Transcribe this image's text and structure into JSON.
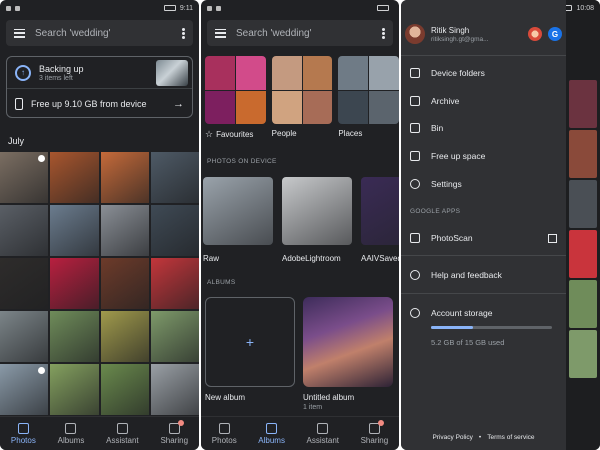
{
  "status": {
    "p1_time": "9:11",
    "p2_time": "",
    "p3_time": "10:08",
    "battery": "75"
  },
  "search": {
    "placeholder": "Search 'wedding'"
  },
  "photos_panel": {
    "backup_title": "Backing up",
    "backup_sub": "3 items left",
    "free_up": "Free up 9.10 GB from device",
    "month": "July",
    "thumb_colors": [
      "#7b6e62",
      "#a8562e",
      "#c46a3a",
      "#4e5a66",
      "#5a5f66",
      "#6b7c8e",
      "#8a8f96",
      "#3f4a55",
      "#2e2c2b",
      "#b81f3f",
      "#6d3b2a",
      "#c3363b",
      "#7c8589",
      "#6f8c5a",
      "#a09a4c",
      "#7e9a6a",
      "#8a9aa8",
      "#84a05f",
      "#6a8a4d",
      "#9aa0a6"
    ]
  },
  "albums_panel": {
    "categories": [
      {
        "label": "Favourites",
        "colors": [
          "#a8305d",
          "#d24b8a",
          "#7d1f5f",
          "#c96a2e"
        ]
      },
      {
        "label": "People",
        "colors": [
          "#c49a80",
          "#b5794f",
          "#d0a380",
          "#a76c57"
        ]
      },
      {
        "label": "Places",
        "colors": [
          "#6f7b86",
          "#98a2ab",
          "#3c4650",
          "#5b646d"
        ]
      }
    ],
    "section_device": "PHOTOS ON DEVICE",
    "device": [
      {
        "label": "Raw",
        "color": "#9aa3ab"
      },
      {
        "label": "AdobeLightroom",
        "color": "#c7c9cb"
      },
      {
        "label": "AAIVSaved",
        "color": "#3a2b55"
      }
    ],
    "section_albums": "ALBUMS",
    "new_album": "New album",
    "untitled_album": "Untitled album",
    "untitled_count": "1 item"
  },
  "nav": {
    "photos": "Photos",
    "albums": "Albums",
    "assistant": "Assistant",
    "sharing": "Sharing"
  },
  "drawer": {
    "name": "Ritik Singh",
    "email": "ritiksingh.gt@gma...",
    "menu": [
      "Device folders",
      "Archive",
      "Bin",
      "Free up space",
      "Settings"
    ],
    "google_apps": "GOOGLE APPS",
    "photoscan": "PhotoScan",
    "help": "Help and feedback",
    "account_storage": "Account storage",
    "storage_used_text": "5.2 GB of 15 GB used",
    "storage_fraction": 0.35,
    "privacy": "Privacy Policy",
    "terms": "Terms of service",
    "bullet": "•"
  },
  "colors": {
    "accent": "#8ab4f8",
    "bg": "#202124",
    "drawer": "#303134"
  }
}
